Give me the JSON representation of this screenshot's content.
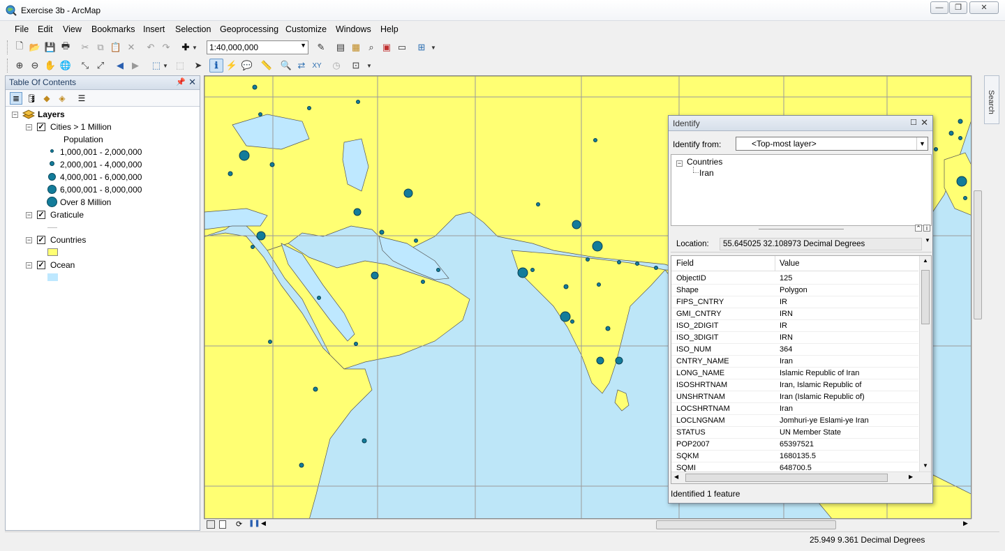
{
  "window": {
    "title": "Exercise 3b - ArcMap",
    "minimize": "—",
    "restore": "❐",
    "close": "✕"
  },
  "menu": [
    "File",
    "Edit",
    "View",
    "Bookmarks",
    "Insert",
    "Selection",
    "Geoprocessing",
    "Customize",
    "Windows",
    "Help"
  ],
  "toolbar": {
    "scale": "1:40,000,000"
  },
  "toc": {
    "title": "Table Of Contents",
    "root": "Layers",
    "cities_layer": "Cities > 1 Million",
    "population_heading": "Population",
    "classes": [
      "1,000,001 - 2,000,000",
      "2,000,001 - 4,000,000",
      "4,000,001 - 6,000,000",
      "6,000,001 - 8,000,000",
      "Over 8 Million"
    ],
    "graticule_layer": "Graticule",
    "countries_layer": "Countries",
    "ocean_layer": "Ocean"
  },
  "colors": {
    "land": "#ffff73",
    "ocean": "#bee8ff",
    "city": "#137c9a"
  },
  "search_tab": "Search",
  "identify": {
    "title": "Identify",
    "from_label": "Identify from:",
    "from_value": "<Top-most layer>",
    "tree_parent": "Countries",
    "tree_child": "Iran",
    "location_label": "Location:",
    "location_value": "55.645025  32.108973 Decimal Degrees",
    "col_field": "Field",
    "col_value": "Value",
    "rows": [
      {
        "field": "ObjectID",
        "value": "125"
      },
      {
        "field": "Shape",
        "value": "Polygon"
      },
      {
        "field": "FIPS_CNTRY",
        "value": "IR"
      },
      {
        "field": "GMI_CNTRY",
        "value": "IRN"
      },
      {
        "field": "ISO_2DIGIT",
        "value": "IR"
      },
      {
        "field": "ISO_3DIGIT",
        "value": "IRN"
      },
      {
        "field": "ISO_NUM",
        "value": "364"
      },
      {
        "field": "CNTRY_NAME",
        "value": "Iran"
      },
      {
        "field": "LONG_NAME",
        "value": "Islamic Republic of Iran"
      },
      {
        "field": "ISOSHRTNAM",
        "value": "Iran, Islamic Republic of"
      },
      {
        "field": "UNSHRTNAM",
        "value": "Iran (Islamic Republic of)"
      },
      {
        "field": "LOCSHRTNAM",
        "value": "Iran"
      },
      {
        "field": "LOCLNGNAM",
        "value": "Jomhuri-ye Eslami-ye Iran"
      },
      {
        "field": "STATUS",
        "value": "UN Member State"
      },
      {
        "field": "POP2007",
        "value": "65397521"
      },
      {
        "field": "SQKM",
        "value": "1680135.5"
      },
      {
        "field": "SQMI",
        "value": "648700.5"
      }
    ],
    "status": "Identified 1 feature"
  },
  "statusbar": {
    "coords": "25.949  9.361 Decimal Degrees"
  }
}
